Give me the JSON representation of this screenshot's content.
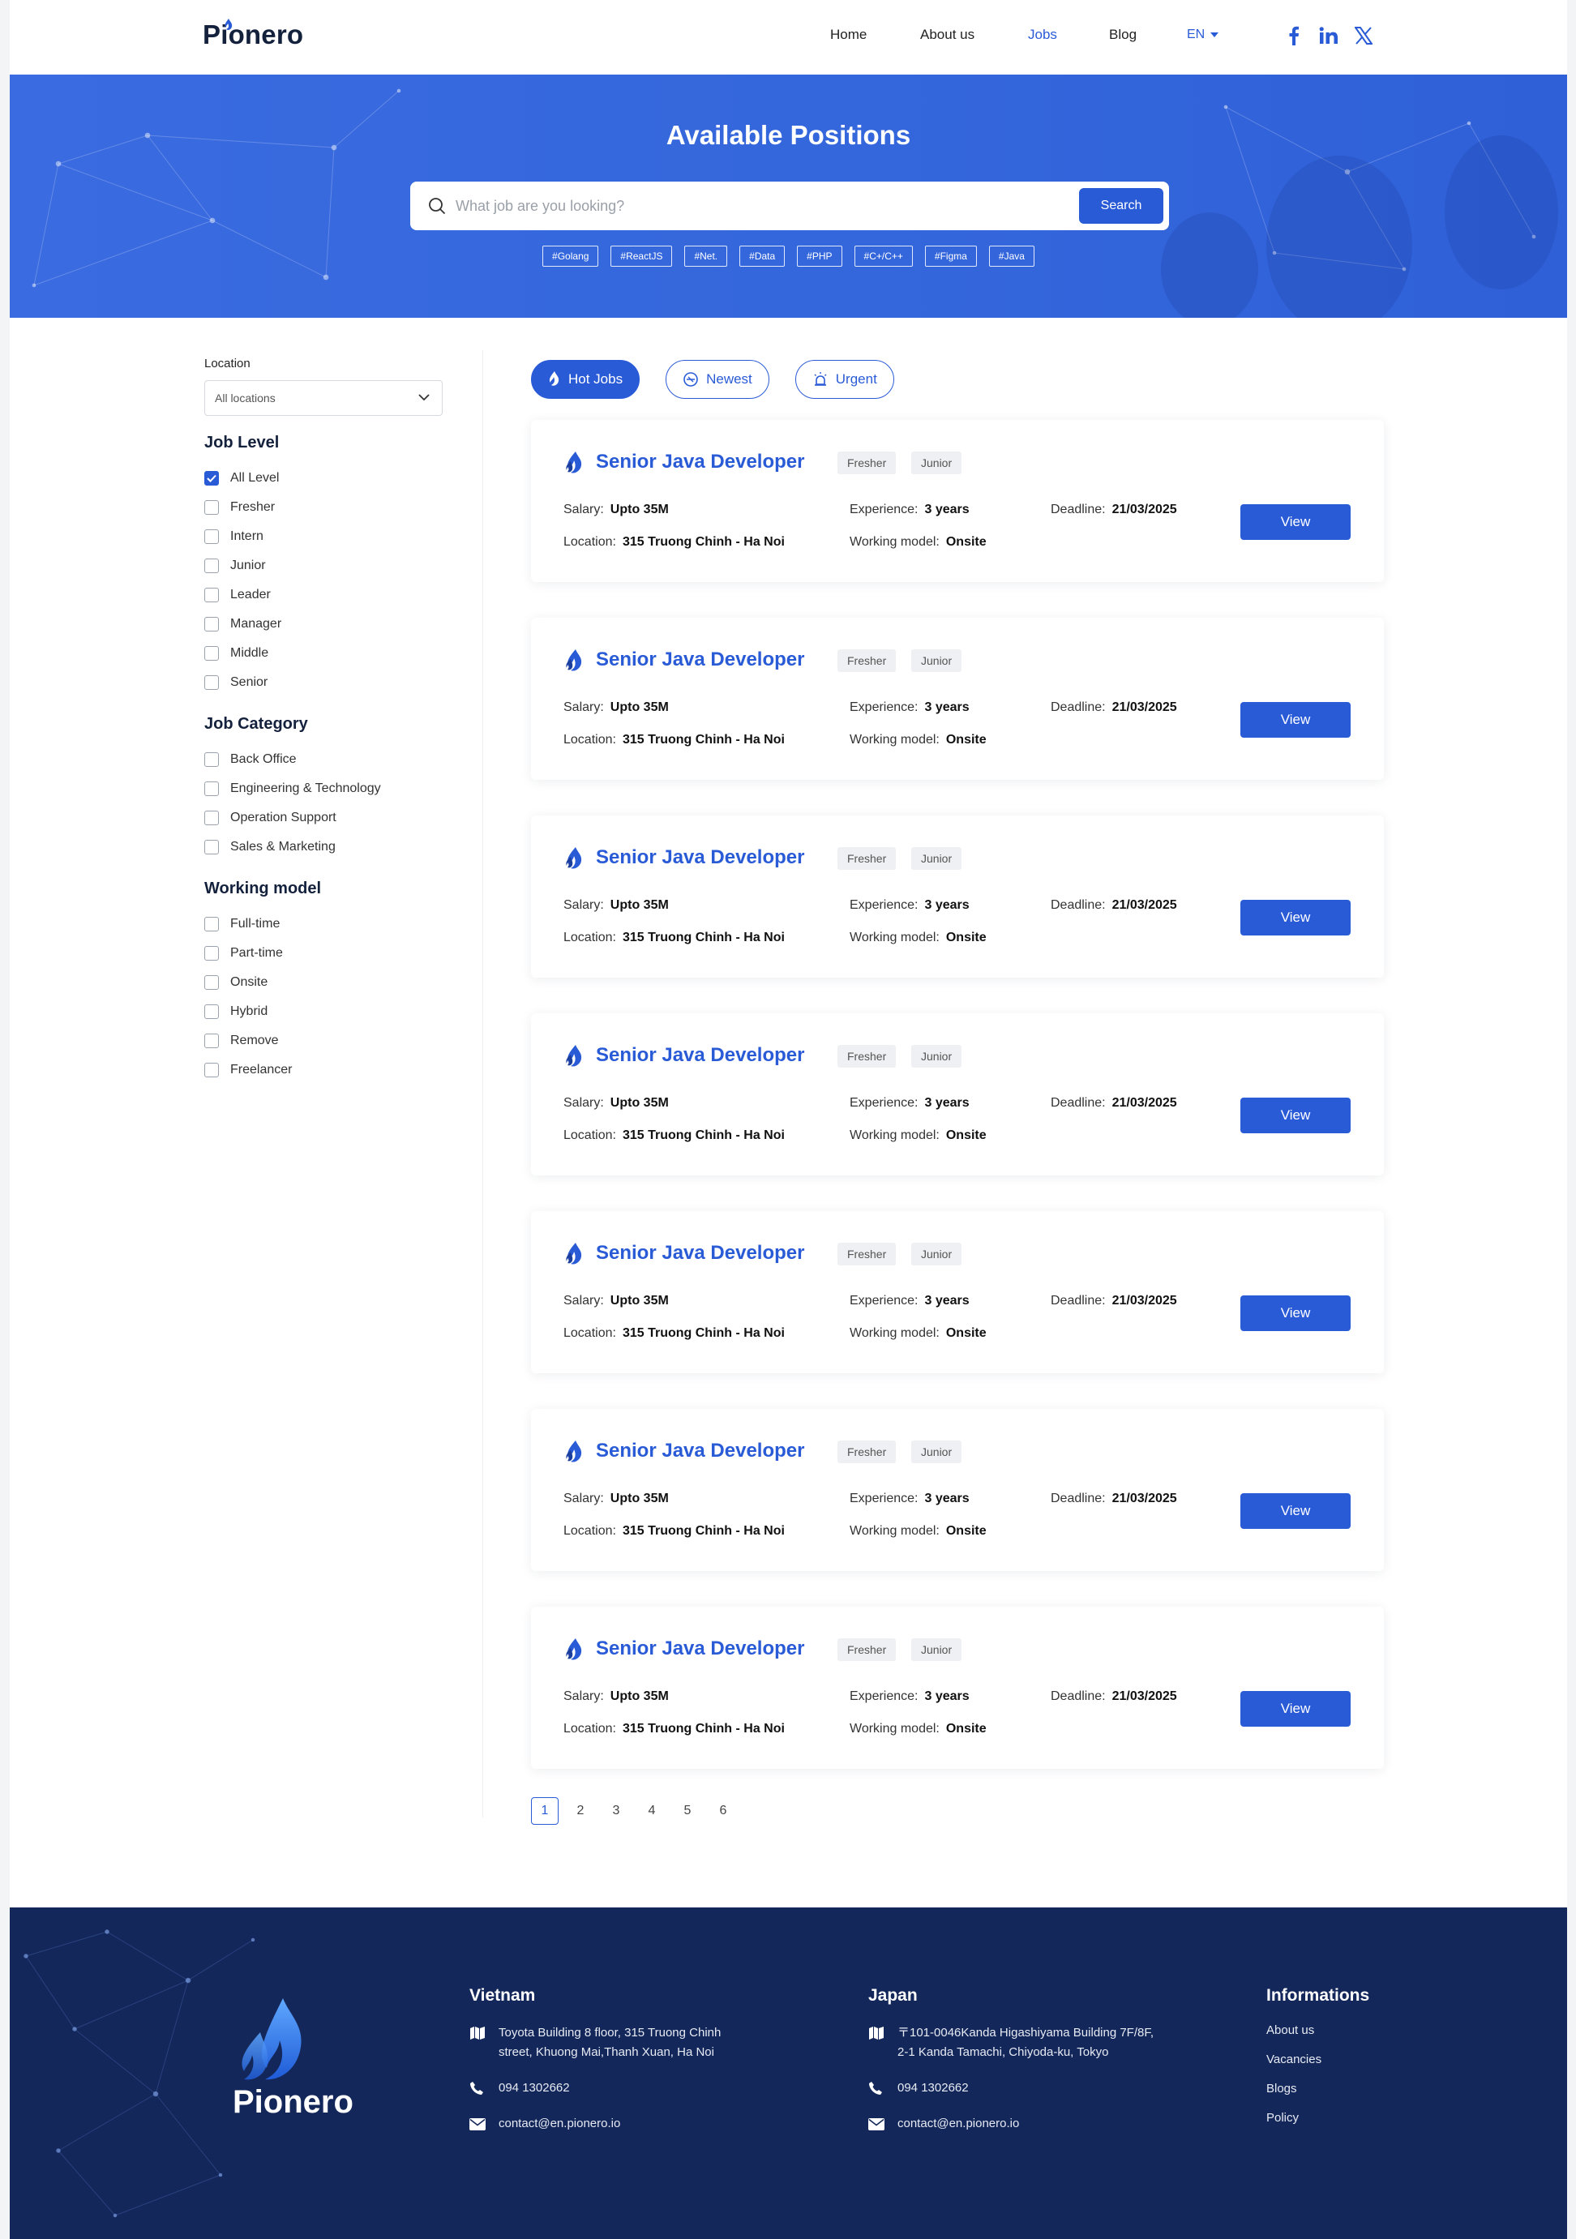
{
  "brand": {
    "name": "Pionero"
  },
  "nav": {
    "items": [
      {
        "label": "Home",
        "active": false
      },
      {
        "label": "About us",
        "active": false
      },
      {
        "label": "Jobs",
        "active": true
      },
      {
        "label": "Blog",
        "active": false
      }
    ],
    "language": "EN"
  },
  "social": [
    "facebook-icon",
    "linkedin-icon",
    "x-icon"
  ],
  "hero": {
    "title": "Available Positions",
    "search_placeholder": "What job are you looking?",
    "search_button": "Search",
    "tags": [
      "#Golang",
      "#ReactJS",
      "#Net.",
      "#Data",
      "#PHP",
      "#C+/C++",
      "#Figma",
      "#Java"
    ]
  },
  "sidebar": {
    "location_label": "Location",
    "location_value": "All locations",
    "job_level": {
      "title": "Job Level",
      "options": [
        {
          "label": "All Level",
          "checked": true
        },
        {
          "label": "Fresher",
          "checked": false
        },
        {
          "label": "Intern",
          "checked": false
        },
        {
          "label": "Junior",
          "checked": false
        },
        {
          "label": "Leader",
          "checked": false
        },
        {
          "label": "Manager",
          "checked": false
        },
        {
          "label": "Middle",
          "checked": false
        },
        {
          "label": "Senior",
          "checked": false
        }
      ]
    },
    "job_category": {
      "title": "Job Category",
      "options": [
        {
          "label": "Back Office",
          "checked": false
        },
        {
          "label": "Engineering & Technology",
          "checked": false
        },
        {
          "label": "Operation Support",
          "checked": false
        },
        {
          "label": "Sales & Marketing",
          "checked": false
        }
      ]
    },
    "working_model": {
      "title": "Working model",
      "options": [
        {
          "label": "Full-time",
          "checked": false
        },
        {
          "label": "Part-time",
          "checked": false
        },
        {
          "label": "Onsite",
          "checked": false
        },
        {
          "label": "Hybrid",
          "checked": false
        },
        {
          "label": "Remove",
          "checked": false
        },
        {
          "label": "Freelancer",
          "checked": false
        }
      ]
    }
  },
  "filters": [
    {
      "label": "Hot Jobs",
      "icon": "flame-icon",
      "active": true
    },
    {
      "label": "Newest",
      "icon": "badge-icon",
      "active": false
    },
    {
      "label": "Urgent",
      "icon": "siren-icon",
      "active": false
    }
  ],
  "jobs": [
    {
      "title": "Senior Java Developer",
      "levels": [
        "Fresher",
        "Junior"
      ],
      "salary_label": "Salary:",
      "salary": "Upto 35M",
      "experience_label": "Experience:",
      "experience": "3 years",
      "deadline_label": "Deadline:",
      "deadline": "21/03/2025",
      "location_label": "Location:",
      "location": "315 Truong Chinh - Ha Noi",
      "model_label": "Working model:",
      "model": "Onsite",
      "view": "View"
    },
    {
      "title": "Senior Java Developer",
      "levels": [
        "Fresher",
        "Junior"
      ],
      "salary_label": "Salary:",
      "salary": "Upto 35M",
      "experience_label": "Experience:",
      "experience": "3 years",
      "deadline_label": "Deadline:",
      "deadline": "21/03/2025",
      "location_label": "Location:",
      "location": "315 Truong Chinh - Ha Noi",
      "model_label": "Working model:",
      "model": "Onsite",
      "view": "View"
    },
    {
      "title": "Senior Java Developer",
      "levels": [
        "Fresher",
        "Junior"
      ],
      "salary_label": "Salary:",
      "salary": "Upto 35M",
      "experience_label": "Experience:",
      "experience": "3 years",
      "deadline_label": "Deadline:",
      "deadline": "21/03/2025",
      "location_label": "Location:",
      "location": "315 Truong Chinh - Ha Noi",
      "model_label": "Working model:",
      "model": "Onsite",
      "view": "View"
    },
    {
      "title": "Senior Java Developer",
      "levels": [
        "Fresher",
        "Junior"
      ],
      "salary_label": "Salary:",
      "salary": "Upto 35M",
      "experience_label": "Experience:",
      "experience": "3 years",
      "deadline_label": "Deadline:",
      "deadline": "21/03/2025",
      "location_label": "Location:",
      "location": "315 Truong Chinh - Ha Noi",
      "model_label": "Working model:",
      "model": "Onsite",
      "view": "View"
    },
    {
      "title": "Senior Java Developer",
      "levels": [
        "Fresher",
        "Junior"
      ],
      "salary_label": "Salary:",
      "salary": "Upto 35M",
      "experience_label": "Experience:",
      "experience": "3 years",
      "deadline_label": "Deadline:",
      "deadline": "21/03/2025",
      "location_label": "Location:",
      "location": "315 Truong Chinh - Ha Noi",
      "model_label": "Working model:",
      "model": "Onsite",
      "view": "View"
    },
    {
      "title": "Senior Java Developer",
      "levels": [
        "Fresher",
        "Junior"
      ],
      "salary_label": "Salary:",
      "salary": "Upto 35M",
      "experience_label": "Experience:",
      "experience": "3 years",
      "deadline_label": "Deadline:",
      "deadline": "21/03/2025",
      "location_label": "Location:",
      "location": "315 Truong Chinh - Ha Noi",
      "model_label": "Working model:",
      "model": "Onsite",
      "view": "View"
    },
    {
      "title": "Senior Java Developer",
      "levels": [
        "Fresher",
        "Junior"
      ],
      "salary_label": "Salary:",
      "salary": "Upto 35M",
      "experience_label": "Experience:",
      "experience": "3 years",
      "deadline_label": "Deadline:",
      "deadline": "21/03/2025",
      "location_label": "Location:",
      "location": "315 Truong Chinh - Ha Noi",
      "model_label": "Working model:",
      "model": "Onsite",
      "view": "View"
    }
  ],
  "pagination": {
    "pages": [
      "1",
      "2",
      "3",
      "4",
      "5",
      "6"
    ],
    "current": "1"
  },
  "footer": {
    "brand": "Pionero",
    "vietnam": {
      "title": "Vietnam",
      "address_line1": "Toyota Building 8 floor, 315 Truong Chinh",
      "address_line2": "street, Khuong Mai,Thanh Xuan, Ha Noi",
      "phone": "094 1302662",
      "email": "contact@en.pionero.io"
    },
    "japan": {
      "title": "Japan",
      "address_line1": "〒101-0046Kanda Higashiyama Building 7F/8F,",
      "address_line2": "2-1 Kanda Tamachi, Chiyoda-ku, Tokyo",
      "phone": "094 1302662",
      "email": "contact@en.pionero.io"
    },
    "informations": {
      "title": "Informations",
      "links": [
        "About us",
        "Vacancies",
        "Blogs",
        "Policy"
      ]
    }
  },
  "colors": {
    "primary": "#2a5bd7",
    "navy": "#14275a",
    "text": "#14213d"
  }
}
